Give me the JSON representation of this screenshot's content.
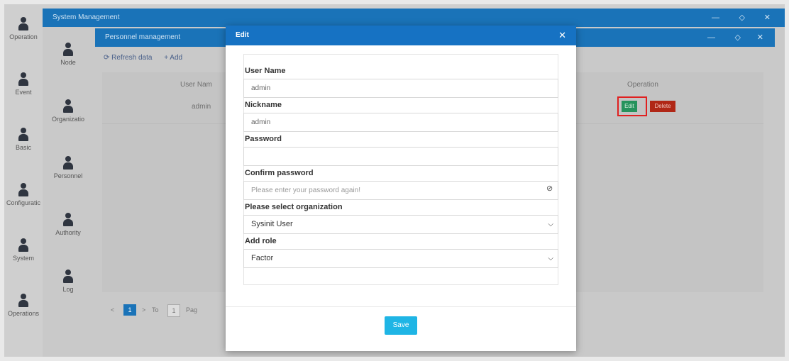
{
  "rail": {
    "items": [
      {
        "label": "Operation",
        "icon": "user-icon"
      },
      {
        "label": "Event",
        "icon": "user-icon"
      },
      {
        "label": "Basic",
        "icon": "user-icon"
      },
      {
        "label": "Configuratic",
        "icon": "user-icon"
      },
      {
        "label": "System",
        "icon": "user-icon"
      },
      {
        "label": "Operations",
        "icon": "user-icon"
      }
    ]
  },
  "system_window": {
    "title": "System Management",
    "controls": {
      "minimize": "—",
      "restore": "◇",
      "close": "✕"
    },
    "sidebar": [
      {
        "label": "Node",
        "icon": "user-icon"
      },
      {
        "label": "Organizatio",
        "icon": "user-icon"
      },
      {
        "label": "Personnel",
        "icon": "user-icon"
      },
      {
        "label": "Authority",
        "icon": "user-icon"
      },
      {
        "label": "Log",
        "icon": "user-icon"
      }
    ]
  },
  "personnel_window": {
    "title": "Personnel management",
    "controls": {
      "minimize": "—",
      "restore": "◇",
      "close": "✕"
    },
    "toolbar": {
      "refresh": "⟳ Refresh data",
      "add": "+ Add"
    },
    "table": {
      "headers": {
        "user_name": "User Nam",
        "operation": "Operation"
      },
      "rows": [
        {
          "user_name": "admin",
          "edit": "Edit",
          "delete": "Delete"
        }
      ]
    },
    "pager": {
      "prev": "<",
      "page": "1",
      "next": ">",
      "goto": "To",
      "goto_value": "1",
      "page_label": "Pag"
    }
  },
  "modal": {
    "title": "Edit",
    "close": "✕",
    "fields": {
      "user_name": {
        "label": "User Name",
        "value": "admin"
      },
      "nickname": {
        "label": "Nickname",
        "value": "admin"
      },
      "password": {
        "label": "Password",
        "value": ""
      },
      "confirm_password": {
        "label": "Confirm password",
        "placeholder": "Please enter your password again!"
      },
      "organization": {
        "label": "Please select organization",
        "value": "Sysinit User"
      },
      "role": {
        "label": "Add role",
        "value": "Factor"
      }
    },
    "eye_icon": "eye-slash-icon",
    "save": "Save"
  },
  "colors": {
    "title_bar": "#1a73b8",
    "modal_header": "#1672c3",
    "save_button": "#1fb5e5",
    "edit_button": "#26925c",
    "delete_button": "#b02716",
    "highlight": "#e02020"
  }
}
